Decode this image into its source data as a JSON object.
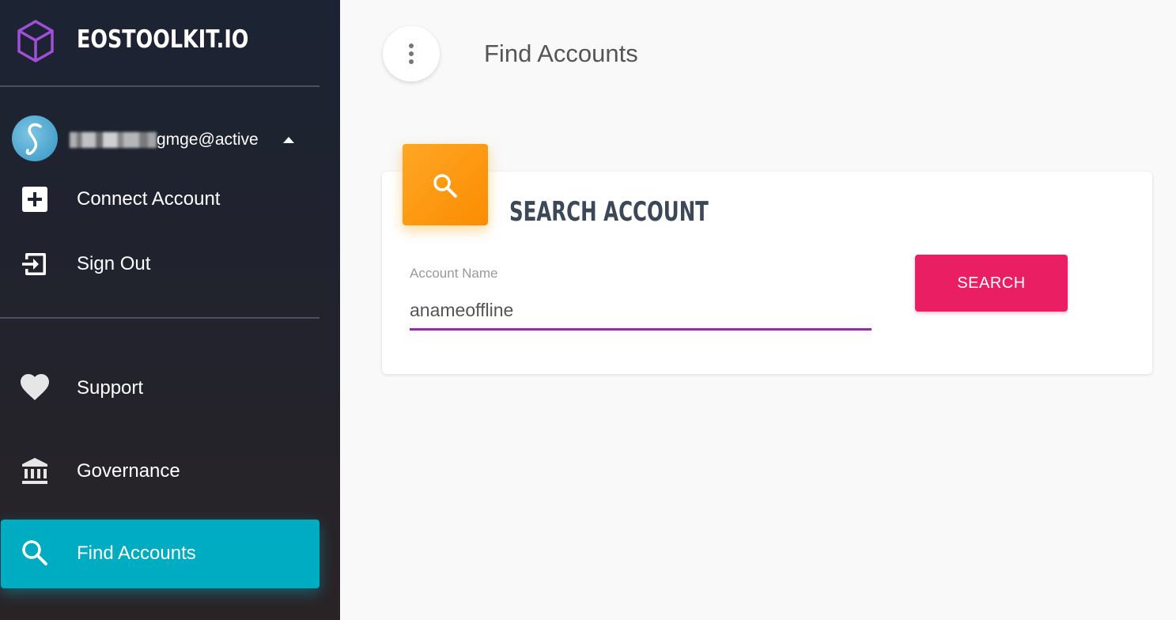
{
  "app": {
    "logo_text": "EOSTOOLKIT.IO"
  },
  "user": {
    "account_label": "gmge@active"
  },
  "sidebar": {
    "items": [
      {
        "label": "Connect Account",
        "icon": "plus-box-icon"
      },
      {
        "label": "Sign Out",
        "icon": "exit-icon"
      },
      {
        "label": "Support",
        "icon": "heart-icon"
      },
      {
        "label": "Governance",
        "icon": "bank-icon"
      },
      {
        "label": "Find Accounts",
        "icon": "search-icon",
        "active": true
      }
    ]
  },
  "header": {
    "title": "Find Accounts"
  },
  "card": {
    "title": "SEARCH ACCOUNT",
    "field_label": "Account Name",
    "field_value": "anameoffline",
    "button_label": "SEARCH"
  },
  "colors": {
    "sidebar_bg": "#1c2333",
    "active_item": "#00acc1",
    "card_icon": "#fb8c00",
    "search_button": "#e91e63",
    "input_underline": "#9c27b0",
    "logo_accent": "#9c4dcc"
  }
}
